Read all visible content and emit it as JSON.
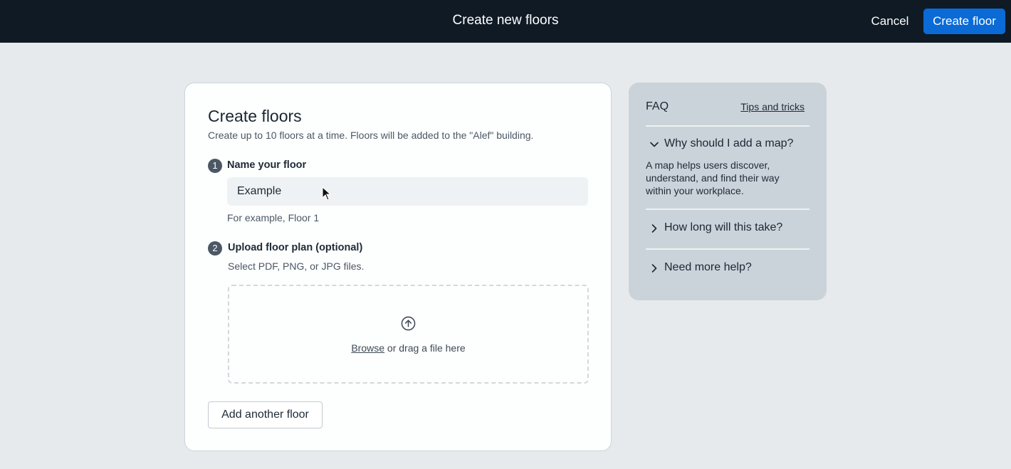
{
  "header": {
    "title": "Create new floors",
    "cancel_label": "Cancel",
    "create_label": "Create floor"
  },
  "form": {
    "title": "Create floors",
    "subtitle": "Create up to 10 floors at a time. Floors will be added to the \"Alef\" building.",
    "step1": {
      "number": "1",
      "label": "Name your floor",
      "value": "Example",
      "helper": "For example, Floor 1"
    },
    "step2": {
      "number": "2",
      "label": "Upload floor plan (optional)",
      "helper": "Select PDF, PNG, or JPG files.",
      "browse_label": "Browse",
      "drop_text": " or drag a file here",
      "icon": "upload-icon"
    },
    "add_floor_label": "Add another floor"
  },
  "faq": {
    "title": "FAQ",
    "tips_label": "Tips and tricks",
    "items": [
      {
        "question": "Why should I add a map?",
        "expanded": true,
        "answer": "A map helps users discover, understand, and find their way within your workplace."
      },
      {
        "question": "How long will this take?",
        "expanded": false
      },
      {
        "question": "Need more help?",
        "expanded": false
      }
    ]
  },
  "colors": {
    "topbar": "#0f1a24",
    "primary": "#0a6ad6",
    "page_bg": "#e6eaec",
    "faq_bg": "#cbd3da"
  }
}
